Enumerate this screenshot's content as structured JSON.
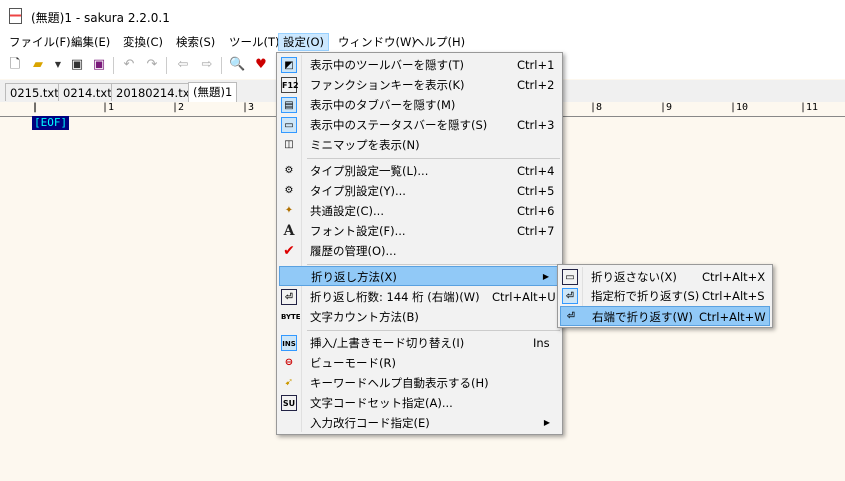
{
  "window": {
    "title": "(無題)1 - sakura 2.2.0.1"
  },
  "menubar": [
    "ファイル(F)",
    "編集(E)",
    "変換(C)",
    "検索(S)",
    "ツール(T)",
    "設定(O)",
    "ウィンドウ(W)",
    "ヘルプ(H)"
  ],
  "tabs": [
    "0215.txt",
    "0214.txt",
    "20180214.txt",
    "(無題)1"
  ],
  "ruler": [
    "1",
    "2",
    "3",
    "8",
    "9",
    "10",
    "11"
  ],
  "editor": {
    "eof": "[EOF]"
  },
  "settings_menu": [
    {
      "label": "表示中のツールバーを隠す(T)",
      "shortcut": "Ctrl+1",
      "icon": "toolbar-icon"
    },
    {
      "label": "ファンクションキーを表示(K)",
      "shortcut": "Ctrl+2",
      "icon": "function-key-icon"
    },
    {
      "label": "表示中のタブバーを隠す(M)",
      "shortcut": "",
      "icon": "tabbar-icon"
    },
    {
      "label": "表示中のステータスバーを隠す(S)",
      "shortcut": "Ctrl+3",
      "icon": "statusbar-icon"
    },
    {
      "label": "ミニマップを表示(N)",
      "shortcut": "",
      "icon": "minimap-icon"
    },
    {
      "label": "タイプ別設定一覧(L)...",
      "shortcut": "Ctrl+4",
      "icon": "type-list-icon"
    },
    {
      "label": "タイプ別設定(Y)...",
      "shortcut": "Ctrl+5",
      "icon": "type-settings-icon"
    },
    {
      "label": "共通設定(C)...",
      "shortcut": "Ctrl+6",
      "icon": "common-settings-icon"
    },
    {
      "label": "フォント設定(F)...",
      "shortcut": "Ctrl+7",
      "icon": "font-icon"
    },
    {
      "label": "履歴の管理(O)...",
      "shortcut": "",
      "icon": "checkmark-icon"
    },
    {
      "label": "折り返し方法(X)",
      "shortcut": "",
      "icon": ""
    },
    {
      "label": "折り返し桁数: 144 桁 (右端)(W)",
      "shortcut": "Ctrl+Alt+U",
      "icon": "wrap-column-icon"
    },
    {
      "label": "文字カウント方法(B)",
      "shortcut": "",
      "icon": "byte-icon"
    },
    {
      "label": "挿入/上書きモード切り替え(I)",
      "shortcut": "Ins",
      "icon": "insert-icon"
    },
    {
      "label": "ビューモード(R)",
      "shortcut": "",
      "icon": "view-mode-icon"
    },
    {
      "label": "キーワードヘルプ自動表示する(H)",
      "shortcut": "",
      "icon": "keyword-help-icon"
    },
    {
      "label": "文字コードセット指定(A)...",
      "shortcut": "",
      "icon": "charset-icon"
    },
    {
      "label": "入力改行コード指定(E)",
      "shortcut": "",
      "icon": ""
    }
  ],
  "wrap_submenu": [
    {
      "label": "折り返さない(X)",
      "shortcut": "Ctrl+Alt+X",
      "icon": "no-wrap-icon"
    },
    {
      "label": "指定桁で折り返す(S)",
      "shortcut": "Ctrl+Alt+S",
      "icon": "wrap-at-column-icon"
    },
    {
      "label": "右端で折り返す(W)",
      "shortcut": "Ctrl+Alt+W",
      "icon": "wrap-at-edge-icon"
    }
  ]
}
